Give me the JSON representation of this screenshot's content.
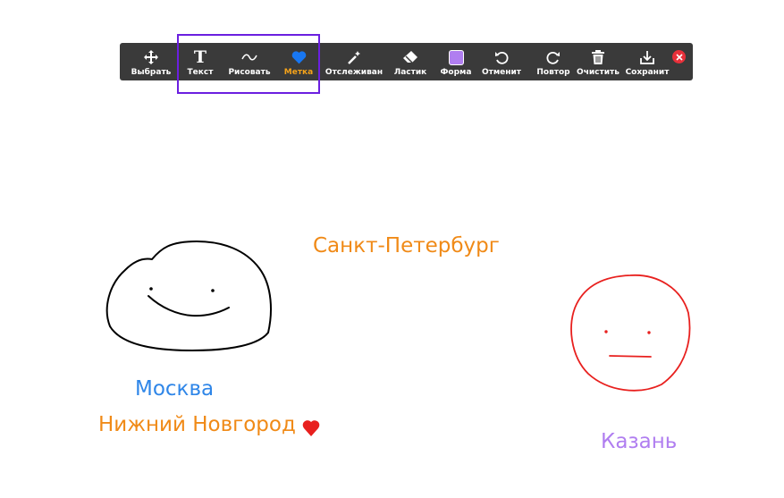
{
  "toolbar": {
    "tools": [
      {
        "label": "Выбрать",
        "icon": "move-arrows-icon"
      },
      {
        "label": "Текст",
        "icon": "text-t-icon"
      },
      {
        "label": "Рисовать",
        "icon": "squiggle-icon"
      },
      {
        "label": "Метка",
        "icon": "heart-stamp-icon",
        "active": true
      },
      {
        "label": "Отслеживан",
        "icon": "magic-wand-icon"
      },
      {
        "label": "Ластик",
        "icon": "eraser-icon"
      },
      {
        "label": "Форма",
        "icon": "shape-square-icon"
      },
      {
        "label": "Отменит",
        "icon": "undo-icon"
      },
      {
        "label": "Повтор",
        "icon": "redo-icon"
      },
      {
        "label": "Очистить",
        "icon": "trash-icon"
      },
      {
        "label": "Сохранит",
        "icon": "save-download-icon"
      }
    ],
    "close_icon": "close-icon"
  },
  "canvas": {
    "labels": {
      "spb": "Санкт-Петербург",
      "moscow": "Москва",
      "nizhny": "Нижний Новгород",
      "kazan": "Казань"
    }
  },
  "colors": {
    "toolbar_bg": "#3a3a3a",
    "active_label": "#f5a31a",
    "highlight_border": "#6b1fe0",
    "blue_text": "#2f86e8",
    "orange_text": "#f08a17",
    "purple_text": "#b07ef0",
    "red_drawing": "#e8201e",
    "heart": "#e8201e"
  }
}
